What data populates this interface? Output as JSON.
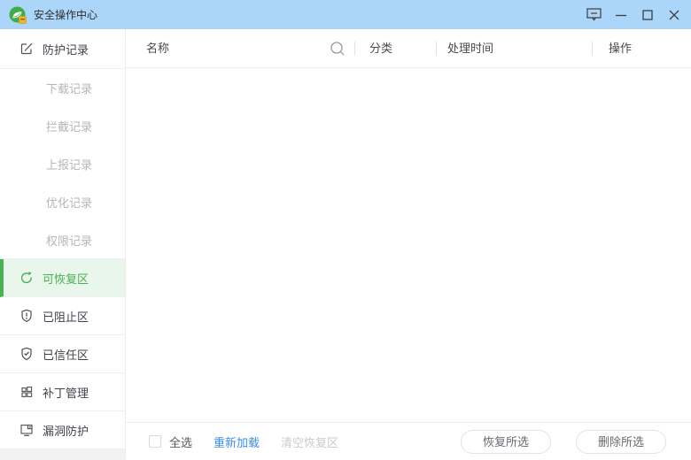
{
  "window": {
    "title": "安全操作中心"
  },
  "titlebar": {
    "icons": [
      "app-logo-icon",
      "feedback-icon",
      "minimize-icon",
      "maximize-icon",
      "close-icon"
    ]
  },
  "sidebar": {
    "items": [
      {
        "label": "防护记录",
        "type": "main",
        "icon": "edit-icon",
        "selected": false
      },
      {
        "label": "下载记录",
        "type": "sub",
        "selected": false
      },
      {
        "label": "拦截记录",
        "type": "sub",
        "selected": false
      },
      {
        "label": "上报记录",
        "type": "sub",
        "selected": false
      },
      {
        "label": "优化记录",
        "type": "sub",
        "selected": false
      },
      {
        "label": "权限记录",
        "type": "sub",
        "selected": false
      },
      {
        "label": "可恢复区",
        "type": "main",
        "icon": "refresh-icon",
        "selected": true
      },
      {
        "label": "已阻止区",
        "type": "main",
        "icon": "shield-exclamation-icon",
        "selected": false
      },
      {
        "label": "已信任区",
        "type": "main",
        "icon": "shield-check-icon",
        "selected": false
      },
      {
        "label": "补丁管理",
        "type": "main",
        "icon": "grid-icon",
        "selected": false
      },
      {
        "label": "漏洞防护",
        "type": "main",
        "icon": "monitor-icon",
        "selected": false
      }
    ]
  },
  "table": {
    "columns": [
      {
        "label": "名称"
      },
      {
        "label": "分类"
      },
      {
        "label": "处理时间"
      },
      {
        "label": "操作"
      }
    ],
    "rows": []
  },
  "footer": {
    "select_all_label": "全选",
    "reload_label": "重新加载",
    "clear_label": "清空恢复区",
    "restore_button": "恢复所选",
    "delete_button": "删除所选"
  },
  "colors": {
    "titlebar_bg": "#abd6fa",
    "accent_green": "#4caf50",
    "selected_bg": "#e9f6ec",
    "link_blue": "#3a8ee6",
    "disabled_text": "#c8cbd0"
  }
}
